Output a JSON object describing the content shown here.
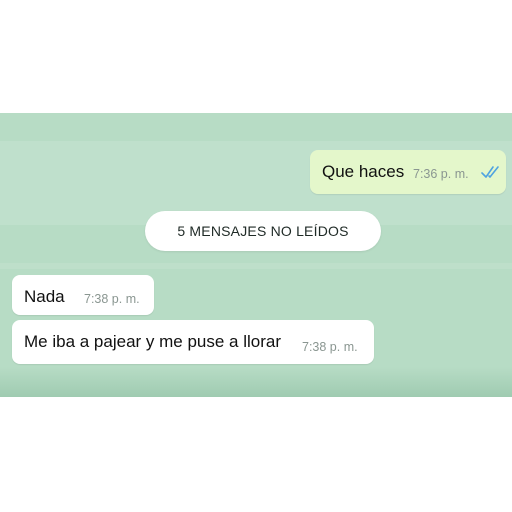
{
  "conversation": {
    "outgoing": [
      {
        "text": "Que haces",
        "time": "7:36 p. m.",
        "status_icon": "double-check-read-icon"
      }
    ],
    "divider": {
      "text": "5 MENSAJES NO LEÍDOS"
    },
    "incoming": [
      {
        "text": "Nada",
        "time": "7:38 p. m."
      },
      {
        "text": "Me iba a pajear y me puse a llorar",
        "time": "7:38 p. m."
      }
    ]
  },
  "colors": {
    "chat_background": "#b7dcc5",
    "outgoing_bubble": "#e4f7cb",
    "incoming_bubble": "#ffffff",
    "read_tick": "#4fa3e0"
  }
}
